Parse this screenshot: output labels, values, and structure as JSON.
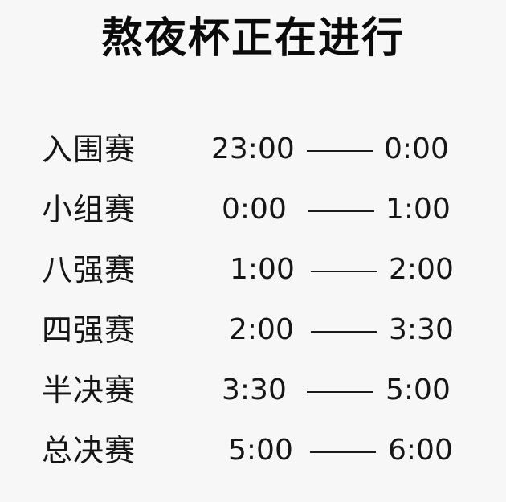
{
  "title": "熬夜杯正在进行",
  "schedule": [
    {
      "stage": "入围赛",
      "start": "23:00",
      "separator": "——",
      "end": "0:00"
    },
    {
      "stage": "小组赛",
      "start": "0:00",
      "separator": "——",
      "end": "1:00"
    },
    {
      "stage": "八强赛",
      "start": "1:00",
      "separator": "——",
      "end": "2:00"
    },
    {
      "stage": "四强赛",
      "start": "2:00",
      "separator": "——",
      "end": "3:30"
    },
    {
      "stage": "半决赛",
      "start": "3:30",
      "separator": "——",
      "end": "5:00"
    },
    {
      "stage": "总决赛",
      "start": "5:00",
      "separator": "——",
      "end": "6:00"
    }
  ]
}
